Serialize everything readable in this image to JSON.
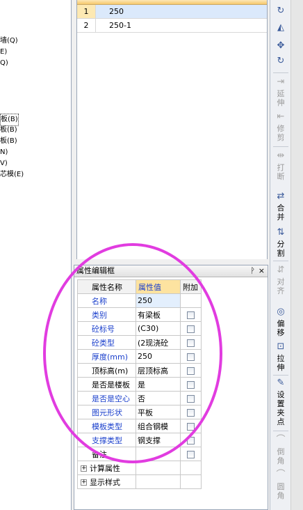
{
  "tree": {
    "items": [
      {
        "label": "墙(Q)"
      },
      {
        "label": "E)"
      },
      {
        "label": "Q)"
      },
      {
        "label": "板(B)"
      },
      {
        "label": "板(B)"
      },
      {
        "label": "板(B)"
      },
      {
        "label": "N)"
      },
      {
        "label": "V)"
      },
      {
        "label": "芯模(E)"
      }
    ]
  },
  "list": {
    "rows": [
      {
        "num": "1",
        "value": "250"
      },
      {
        "num": "2",
        "value": "250-1"
      }
    ]
  },
  "props": {
    "title": "属性编辑框",
    "pin": "ᚹ",
    "close": "×",
    "headers": {
      "name": "属性名称",
      "value": "属性值",
      "extra": "附加"
    },
    "rows": [
      {
        "name": "名称",
        "value": "250"
      },
      {
        "name": "类别",
        "value": "有梁板"
      },
      {
        "name": "砼标号",
        "value": "(C30)"
      },
      {
        "name": "砼类型",
        "value": "(2现浇砼"
      },
      {
        "name": "厚度(mm)",
        "value": "250"
      },
      {
        "name": "顶标高(m)",
        "value": "层顶标高"
      },
      {
        "name": "是否是楼板",
        "value": "是"
      },
      {
        "name": "是否是空心",
        "value": "否"
      },
      {
        "name": "图元形状",
        "value": "平板"
      },
      {
        "name": "模板类型",
        "value": "组合钢模"
      },
      {
        "name": "支撑类型",
        "value": "钢支撑"
      },
      {
        "name": "备注",
        "value": ""
      }
    ],
    "groups": [
      {
        "label": "计算属性",
        "expander": "+"
      },
      {
        "label": "显示样式",
        "expander": "+"
      }
    ]
  },
  "toolbar": {
    "icons": [
      "↻",
      "◭",
      "✥",
      "↻",
      "⇥",
      "⇤",
      "⇹",
      "⇄",
      "⇅",
      "⇵",
      "◎",
      "⊡",
      "✎",
      "⌒",
      "⌒"
    ],
    "tools": [
      {
        "label": "延伸"
      },
      {
        "label": "修剪"
      },
      {
        "label": "打断"
      },
      {
        "label": "合并"
      },
      {
        "label": "分割"
      },
      {
        "label": "对齐"
      },
      {
        "label": "偏移"
      },
      {
        "label": "拉伸"
      },
      {
        "label": "设置夹点"
      },
      {
        "label": "倒角"
      },
      {
        "label": "圆角"
      }
    ]
  },
  "colors": {
    "accent": "#1a3fcc",
    "annotation": "#e13ce0",
    "header": "#fde3a0"
  }
}
